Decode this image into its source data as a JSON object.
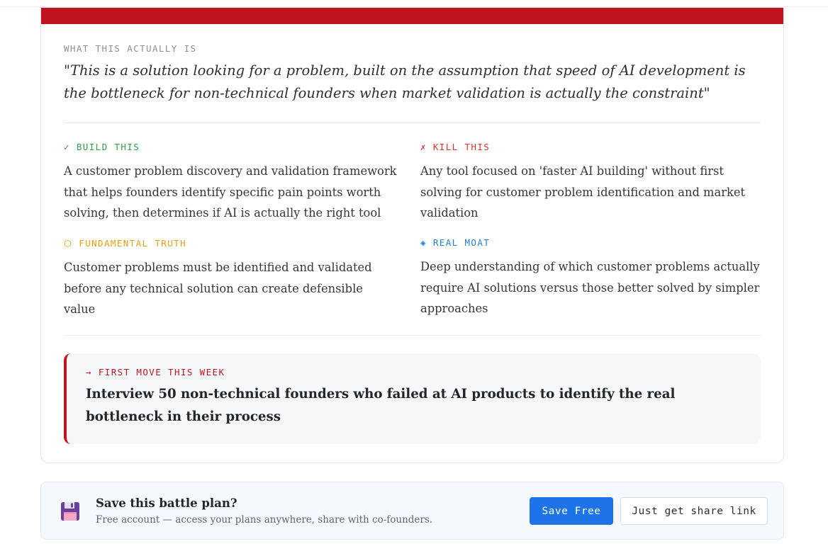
{
  "colors": {
    "accent_red": "#c0141f",
    "build_green": "#2f9e44",
    "kill_red": "#e03131",
    "truth_amber": "#e6a20f",
    "moat_blue": "#1c7ed6",
    "primary_button": "#1c74e8"
  },
  "analysis": {
    "what_label": "WHAT THIS ACTUALLY IS",
    "quote": "\"This is a solution looking for a problem, built on the assumption that speed of AI development is the bottleneck for non-technical founders when market validation is actually the constraint\""
  },
  "sections": {
    "build": {
      "icon": "check-icon",
      "symbol": "✓",
      "label": "BUILD THIS",
      "text": "A customer problem discovery and validation framework that helps founders identify specific pain points worth solving, then determines if AI is actually the right tool"
    },
    "kill": {
      "icon": "x-icon",
      "symbol": "✗",
      "label": "KILL THIS",
      "text": "Any tool focused on 'faster AI building' without first solving for customer problem identification and market validation"
    },
    "truth": {
      "icon": "hexagon-icon",
      "symbol": "⬡",
      "label": "FUNDAMENTAL TRUTH",
      "text": "Customer problems must be identified and validated before any technical solution can create defensible value"
    },
    "moat": {
      "icon": "diamond-icon",
      "symbol": "◈",
      "label": "REAL MOAT",
      "text": "Deep understanding of which customer problems actually require AI solutions versus those better solved by simpler approaches"
    }
  },
  "first_move": {
    "icon": "arrow-right-icon",
    "symbol": "→",
    "label": "FIRST MOVE THIS WEEK",
    "text": "Interview 50 non-technical founders who failed at AI products to identify the real bottleneck in their process"
  },
  "save_prompt": {
    "icon": "floppy-disk-icon",
    "title": "Save this battle plan?",
    "subtitle": "Free account — access your plans anywhere, share with co-founders.",
    "save_button": "Save Free",
    "share_button": "Just get share link"
  }
}
